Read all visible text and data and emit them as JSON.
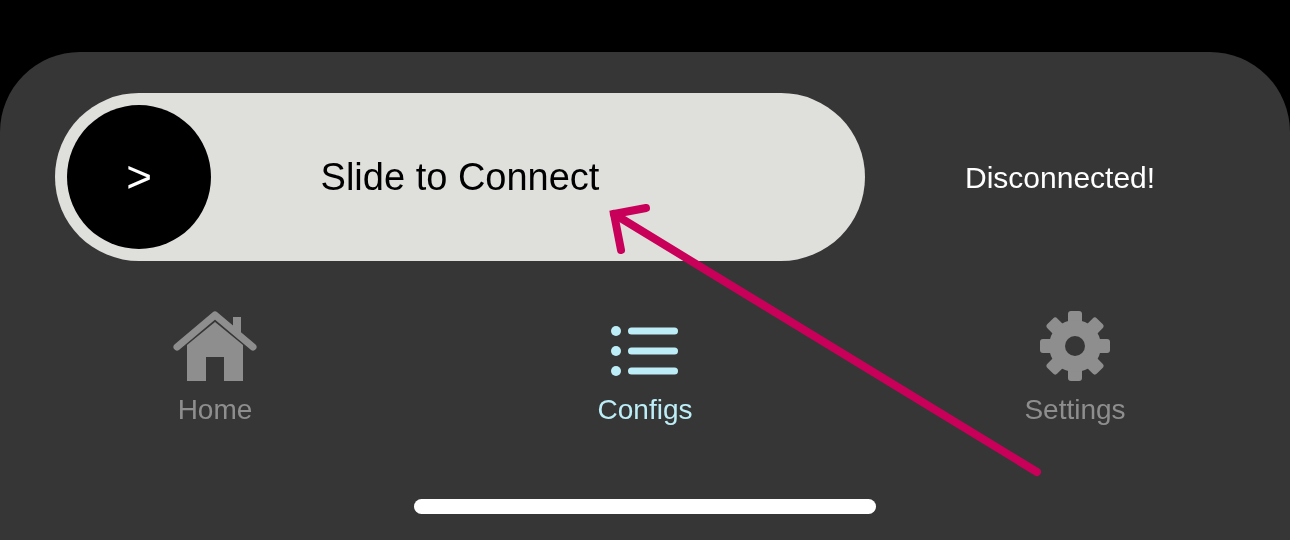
{
  "slider": {
    "label": "Slide to Connect",
    "knob_symbol": ">",
    "level": 0
  },
  "status": "Disconnected!",
  "tabs": [
    {
      "label": "Home",
      "kind": "home",
      "selected": false
    },
    {
      "label": "Configs",
      "kind": "list",
      "selected": true
    },
    {
      "label": "Settings",
      "kind": "gear",
      "selected": false
    }
  ]
}
